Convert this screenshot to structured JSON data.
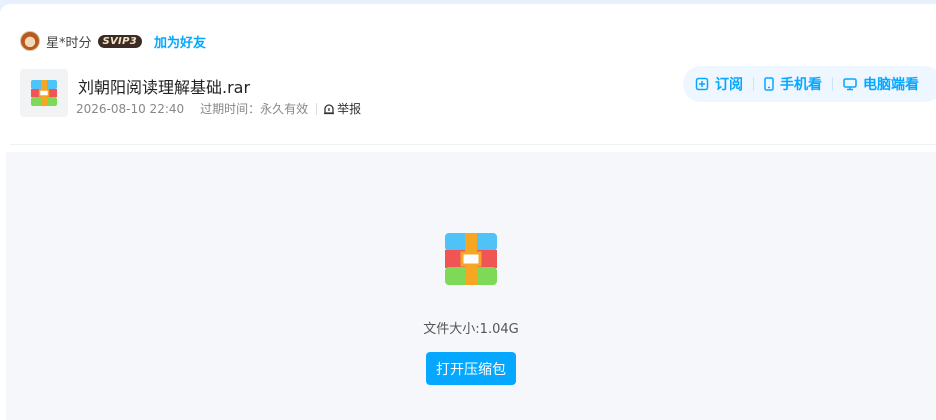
{
  "user": {
    "name": "星*时分",
    "vip_badge": "SVIP3",
    "add_friend": "加为好友"
  },
  "file": {
    "name": "刘朝阳阅读理解基础.rar",
    "date": "2026-08-10 22:40",
    "expire_label": "过期时间：永久有效",
    "report": "举报",
    "size_label": "文件大小:1.04G"
  },
  "actions": {
    "subscribe": "订阅",
    "phone_view": "手机看",
    "pc_view": "电脑端看"
  },
  "open_button": "打开压缩包",
  "colors": {
    "accent": "#06a7ff",
    "vip_badge_bg": "#3b2b24",
    "preview_bg": "#f5f7fa"
  },
  "icons": [
    "avatar",
    "rar-archive-icon",
    "report-icon",
    "subscribe-icon",
    "phone-icon",
    "monitor-icon"
  ]
}
